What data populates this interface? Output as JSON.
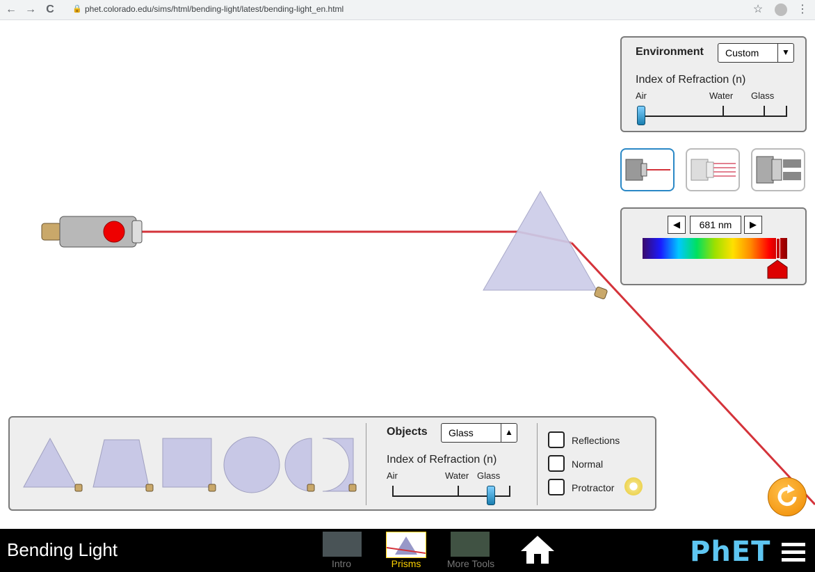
{
  "browser": {
    "url": "phet.colorado.edu/sims/html/bending-light/latest/bending-light_en.html",
    "back_icon": "←",
    "forward_icon": "→",
    "reload_icon": "C",
    "star_icon": "☆",
    "menu_icon": "⋮"
  },
  "environment_panel": {
    "title": "Environment",
    "medium": "Custom",
    "arrow": "▼",
    "index_label": "Index of Refraction (n)",
    "ticks": [
      "Air",
      "Water",
      "Glass"
    ],
    "slider_level": 0.0
  },
  "beam_modes": [
    "ray",
    "wave",
    "white-light"
  ],
  "wavelength": {
    "value": "681 nm",
    "left_arrow": "◀",
    "right_arrow": "▶",
    "slider_fraction": 0.94
  },
  "objects_panel": {
    "title": "Objects",
    "material": "Glass",
    "arrow": "▲",
    "index_label": "Index of Refraction (n)",
    "ticks": [
      "Air",
      "Water",
      "Glass"
    ],
    "slider_level": 0.83
  },
  "checkboxes": {
    "reflections": "Reflections",
    "normal": "Normal",
    "protractor": "Protractor"
  },
  "navbar": {
    "title": "Bending Light",
    "screens": [
      "Intro",
      "Prisms",
      "More Tools"
    ],
    "selected_screen": "Prisms",
    "logo": "PhET",
    "home_icon": "home-icon",
    "hamburger_icon": "menu-icon"
  },
  "colors": {
    "beam": "#d4333a",
    "prism": "#c8c8e6",
    "accent_selected": "#ffd200",
    "phet_blue": "#5ec6f2"
  }
}
